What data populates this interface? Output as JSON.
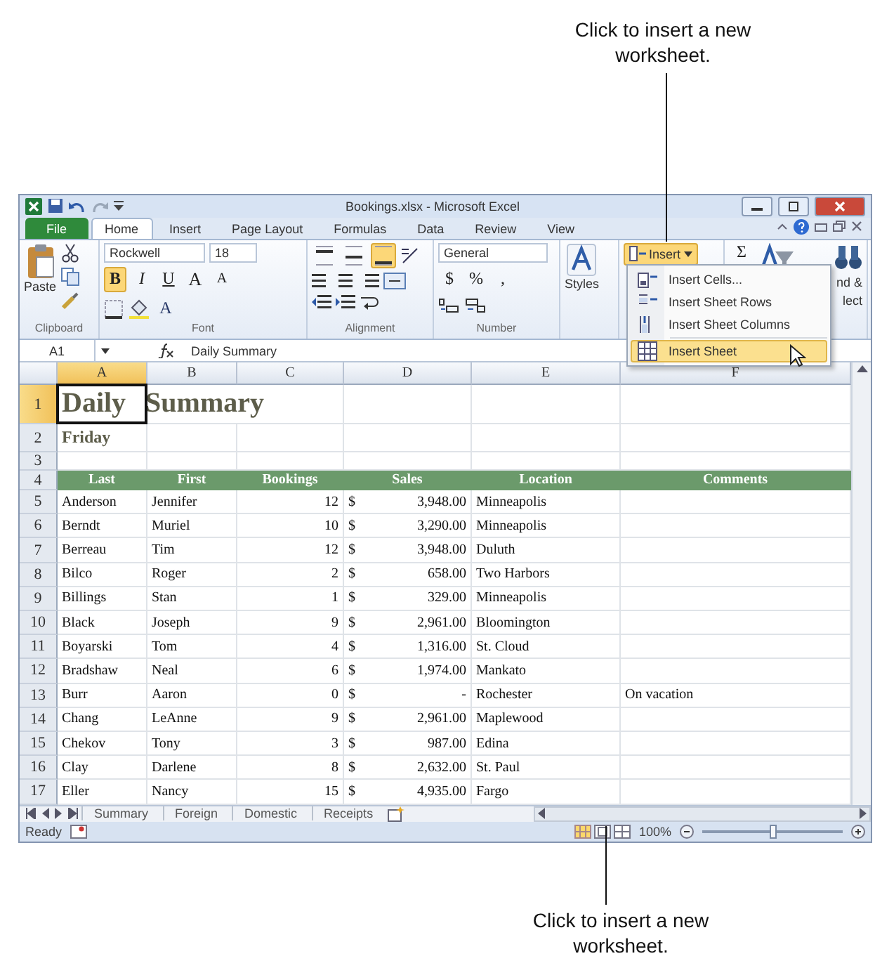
{
  "callouts": [
    {
      "text": "Click to insert a new worksheet."
    },
    {
      "text": "Click to insert a new worksheet."
    }
  ],
  "window": {
    "title": "Bookings.xlsx - Microsoft Excel"
  },
  "ribbon_tabs": [
    {
      "label": "File",
      "kind": "file",
      "selected": false
    },
    {
      "label": "Home",
      "kind": "tab",
      "selected": true
    },
    {
      "label": "Insert",
      "kind": "tab",
      "selected": false
    },
    {
      "label": "Page Layout",
      "kind": "tab",
      "selected": false
    },
    {
      "label": "Formulas",
      "kind": "tab",
      "selected": false
    },
    {
      "label": "Data",
      "kind": "tab",
      "selected": false
    },
    {
      "label": "Review",
      "kind": "tab",
      "selected": false
    },
    {
      "label": "View",
      "kind": "tab",
      "selected": false
    }
  ],
  "ribbon": {
    "clipboard": {
      "paste": "Paste",
      "label": "Clipboard"
    },
    "font": {
      "name": "Rockwell",
      "size": "18",
      "styles": [
        {
          "text": "B",
          "on": true
        },
        {
          "text": "I",
          "on": false
        },
        {
          "text": "U",
          "on": false
        }
      ],
      "grow": "A",
      "shrink": "A",
      "color_letter": "A",
      "label": "Font"
    },
    "alignment": {
      "vertical": [
        {
          "selected": false
        },
        {
          "selected": false
        },
        {
          "selected": true
        }
      ],
      "label": "Alignment"
    },
    "number": {
      "format": "General",
      "symbols": [
        "$",
        "%",
        ","
      ],
      "label": "Number"
    },
    "styles": {
      "label": "Styles"
    },
    "cells": {
      "insert": {
        "label": "Insert",
        "on": true
      }
    },
    "editing": {
      "sum": "Σ",
      "find_lines": [
        "nd &",
        "lect"
      ]
    }
  },
  "menu": {
    "items": [
      {
        "label": "Insert Cells...",
        "selected": false
      },
      {
        "label": "Insert Sheet Rows",
        "selected": false
      },
      {
        "label": "Insert Sheet Columns",
        "selected": false
      },
      {
        "label": "Insert Sheet",
        "selected": true
      }
    ]
  },
  "formula_bar": {
    "name_box": "A1",
    "value": "Daily Summary"
  },
  "sheet": {
    "columns": [
      {
        "label": "A",
        "selected": true
      },
      {
        "label": "B",
        "selected": false
      },
      {
        "label": "C",
        "selected": false
      },
      {
        "label": "D",
        "selected": false
      },
      {
        "label": "E",
        "selected": false
      },
      {
        "label": "F",
        "selected": false
      }
    ],
    "rows": [
      {
        "number": "1",
        "kind": "title",
        "selected": true,
        "text": "Daily Summary"
      },
      {
        "number": "2",
        "kind": "subtitle",
        "selected": false,
        "text": "Friday"
      },
      {
        "number": "3",
        "kind": "blank",
        "selected": false
      },
      {
        "number": "4",
        "kind": "header",
        "selected": false,
        "cells": [
          "Last",
          "First",
          "Bookings",
          "Sales",
          "Location",
          "Comments"
        ]
      },
      {
        "number": "5",
        "kind": "data",
        "selected": false,
        "last": "Anderson",
        "first": "Jennifer",
        "bookings": "12",
        "currency": "$",
        "sales": "3,948.00",
        "location": "Minneapolis"
      },
      {
        "number": "6",
        "kind": "data",
        "selected": false,
        "last": "Berndt",
        "first": "Muriel",
        "bookings": "10",
        "currency": "$",
        "sales": "3,290.00",
        "location": "Minneapolis"
      },
      {
        "number": "7",
        "kind": "data",
        "selected": false,
        "last": "Berreau",
        "first": "Tim",
        "bookings": "12",
        "currency": "$",
        "sales": "3,948.00",
        "location": "Duluth"
      },
      {
        "number": "8",
        "kind": "data",
        "selected": false,
        "last": "Bilco",
        "first": "Roger",
        "bookings": "2",
        "currency": "$",
        "sales": "658.00",
        "location": "Two Harbors"
      },
      {
        "number": "9",
        "kind": "data",
        "selected": false,
        "last": "Billings",
        "first": "Stan",
        "bookings": "1",
        "currency": "$",
        "sales": "329.00",
        "location": "Minneapolis"
      },
      {
        "number": "10",
        "kind": "data",
        "selected": false,
        "last": "Black",
        "first": "Joseph",
        "bookings": "9",
        "currency": "$",
        "sales": "2,961.00",
        "location": "Bloomington"
      },
      {
        "number": "11",
        "kind": "data",
        "selected": false,
        "last": "Boyarski",
        "first": "Tom",
        "bookings": "4",
        "currency": "$",
        "sales": "1,316.00",
        "location": "St. Cloud"
      },
      {
        "number": "12",
        "kind": "data",
        "selected": false,
        "last": "Bradshaw",
        "first": "Neal",
        "bookings": "6",
        "currency": "$",
        "sales": "1,974.00",
        "location": "Mankato"
      },
      {
        "number": "13",
        "kind": "data",
        "selected": false,
        "last": "Burr",
        "first": "Aaron",
        "bookings": "0",
        "currency": "$",
        "sales": "-",
        "location": "Rochester",
        "comments": "On vacation"
      },
      {
        "number": "14",
        "kind": "data",
        "selected": false,
        "last": "Chang",
        "first": "LeAnne",
        "bookings": "9",
        "currency": "$",
        "sales": "2,961.00",
        "location": "Maplewood"
      },
      {
        "number": "15",
        "kind": "data",
        "selected": false,
        "last": "Chekov",
        "first": "Tony",
        "bookings": "3",
        "currency": "$",
        "sales": "987.00",
        "location": "Edina"
      },
      {
        "number": "16",
        "kind": "data",
        "selected": false,
        "last": "Clay",
        "first": "Darlene",
        "bookings": "8",
        "currency": "$",
        "sales": "2,632.00",
        "location": "St. Paul"
      },
      {
        "number": "17",
        "kind": "data",
        "selected": false,
        "last": "Eller",
        "first": "Nancy",
        "bookings": "15",
        "currency": "$",
        "sales": "4,935.00",
        "location": "Fargo"
      }
    ]
  },
  "sheet_tabs": [
    {
      "label": "Summary"
    },
    {
      "label": "Foreign"
    },
    {
      "label": "Domestic"
    },
    {
      "label": "Receipts"
    }
  ],
  "status_bar": {
    "text": "Ready",
    "zoom": "100%",
    "zoom_slider": {
      "level": 0.5
    }
  }
}
